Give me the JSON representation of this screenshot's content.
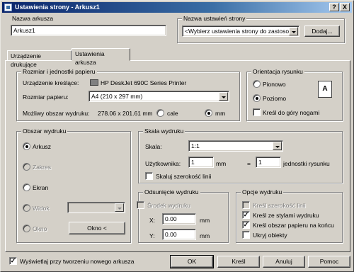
{
  "title": "Ustawienia strony - Arkusz1",
  "title_buttons": {
    "help": "?",
    "close": "X"
  },
  "layout_name": {
    "label": "Nazwa arkusza",
    "value": "Arkusz1"
  },
  "page_setup": {
    "label": "Nazwa ustawień strony",
    "value": "<Wybierz ustawienia strony do zastosow",
    "add_button": "Dodaj..."
  },
  "tabs": [
    "Urządzenie drukujące",
    "Ustawienia arkusza"
  ],
  "paper": {
    "group": "Rozmiar i jednostki papieru",
    "device_label": "Urządzenie kreślące:",
    "device_value": "HP DeskJet 690C Series Printer",
    "size_label": "Rozmiar papieru:",
    "size_value": "A4 (210 x 297 mm)",
    "area_label": "Możliwy obszar wydruku:",
    "area_value": "278.06 x 201.61 mm",
    "unit_inches": "cale",
    "unit_mm": "mm"
  },
  "orientation": {
    "group": "Orientacja rysunku",
    "portrait": "Pionowo",
    "landscape": "Poziomo",
    "upside_down": "Kreśl do góry nogami",
    "page_icon_glyph": "A"
  },
  "print_area": {
    "group": "Obszar wydruku",
    "layout": "Arkusz",
    "extents": "Zakres",
    "display": "Ekran",
    "view": "Widok",
    "window": "Okno",
    "window_button": "Okno <"
  },
  "scale": {
    "group": "Skala wydruku",
    "scale_label": "Skala:",
    "scale_value": "1:1",
    "custom_label": "Użytkownika:",
    "custom_left": "1",
    "unit": "mm",
    "equals": "=",
    "custom_right": "1",
    "drawing_units": "jednostki rysunku",
    "lineweights": "Skaluj szerokość linii"
  },
  "offset": {
    "group": "Odsunięcie wydruku",
    "center": "Środek wydruku",
    "x_label": "X:",
    "x_value": "0.00",
    "y_label": "Y:",
    "y_value": "0.00",
    "unit": "mm"
  },
  "options": {
    "group": "Opcje wydruku",
    "lineweights": "Kreśl szerokość linii",
    "styles": "Kreśl ze stylami wydruku",
    "paperspace_last": "Kreśl obszar papieru na końcu",
    "hide_objects": "Ukryj obiekty",
    "check_glyph": "✓"
  },
  "footer": {
    "show_on_new": "Wyświetlaj przy tworzeniu nowego arkusza",
    "ok": "OK",
    "plot": "Kreśl",
    "cancel": "Anuluj",
    "help": "Pomoc"
  }
}
